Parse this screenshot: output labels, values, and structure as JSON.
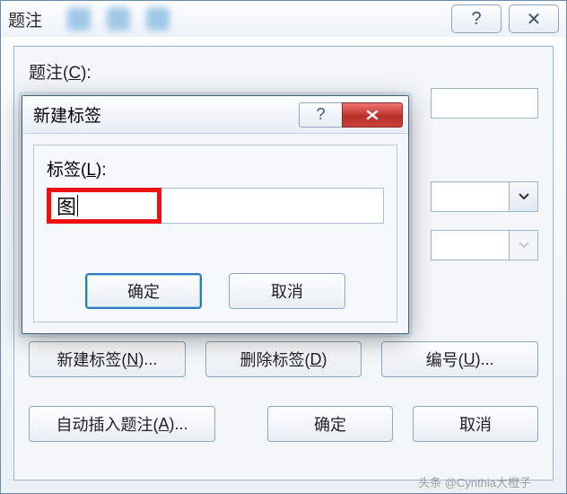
{
  "parent": {
    "title": "题注",
    "help_glyph": "?",
    "close_glyph": "✕",
    "field_caption_prefix": "题注(",
    "field_caption_key": "C",
    "field_caption_suffix": "):",
    "btn_new_label_prefix": "新建标签(",
    "btn_new_label_key": "N",
    "btn_new_label_suffix": ")...",
    "btn_delete_label_prefix": "删除标签(",
    "btn_delete_label_key": "D",
    "btn_delete_label_suffix": ")",
    "btn_numbering_prefix": "编号(",
    "btn_numbering_key": "U",
    "btn_numbering_suffix": ")...",
    "btn_auto_prefix": "自动插入题注(",
    "btn_auto_key": "A",
    "btn_auto_suffix": ")...",
    "btn_ok": "确定",
    "btn_cancel": "取消"
  },
  "modal": {
    "title": "新建标签",
    "label_prefix": "标签(",
    "label_key": "L",
    "label_suffix": "):",
    "input_value": "图",
    "btn_ok": "确定",
    "btn_cancel": "取消"
  },
  "watermark": "头条 @Cynthia大橙子"
}
